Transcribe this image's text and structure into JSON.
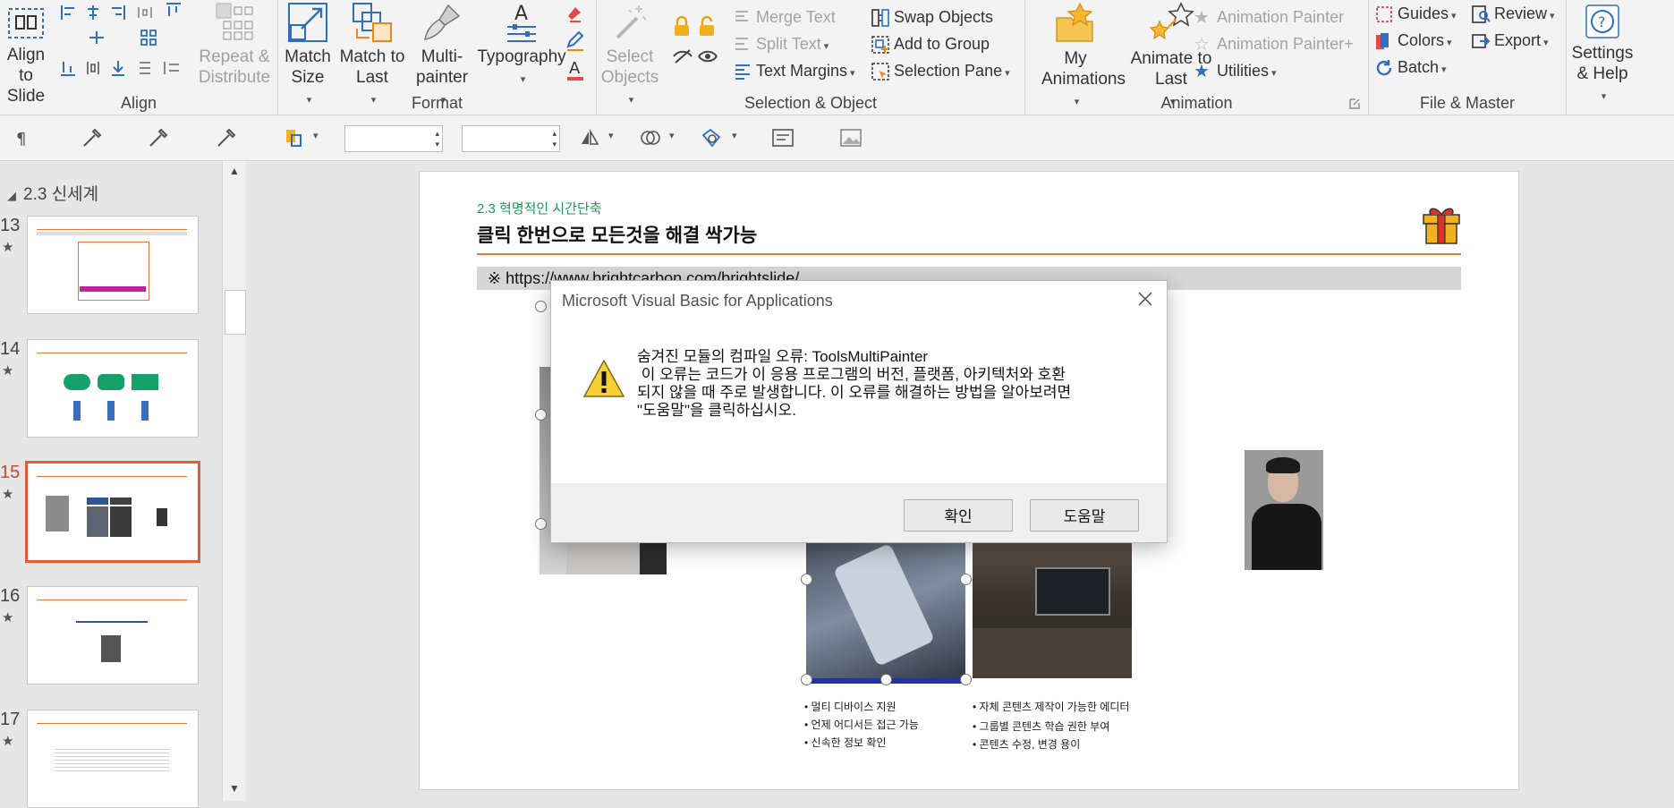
{
  "ribbon": {
    "align": {
      "title": "Align",
      "align_to_slide": "Align to Slide",
      "repeat_distribute": "Repeat & Distribute"
    },
    "format": {
      "title": "Format",
      "match_size": "Match Size",
      "match_to_last": "Match to Last",
      "multi_painter": "Multi-painter",
      "typography": "Typography"
    },
    "selection": {
      "title": "Selection & Object",
      "select_objects": "Select Objects",
      "merge_text": "Merge Text",
      "split_text": "Split Text",
      "text_margins": "Text Margins",
      "swap_objects": "Swap Objects",
      "add_to_group": "Add to Group",
      "selection_pane": "Selection Pane"
    },
    "animation": {
      "title": "Animation",
      "my_animations": "My Animations",
      "animate_to_last": "Animate to Last",
      "animation_painter": "Animation Painter",
      "animation_painter_plus": "Animation Painter+",
      "utilities": "Utilities"
    },
    "file_master": {
      "title": "File & Master",
      "guides": "Guides",
      "colors": "Colors",
      "batch": "Batch",
      "review": "Review",
      "export": "Export"
    },
    "settings": "Settings & Help"
  },
  "slides_pane": {
    "section": "2.3 신세계",
    "slides": [
      {
        "num": "13"
      },
      {
        "num": "14"
      },
      {
        "num": "15"
      },
      {
        "num": "16"
      },
      {
        "num": "17"
      }
    ]
  },
  "slide": {
    "subtitle": "2.3 혁명적인 시간단축",
    "title": "클릭 한번으로 모든것을 해결 싹가능",
    "url": "※ https://www.brightcarbon.com/brightslide/",
    "bullets_left": [
      "멀티 디바이스 지원",
      "언제 어디서든 접근 가능",
      "신속한 정보 확인"
    ],
    "bullets_right": [
      "자체 콘텐츠 제작이 가능한 에디터",
      "그룹별 콘텐츠 학습 권한 부여",
      "콘텐츠 수정, 변경 용이"
    ]
  },
  "dialog": {
    "title": "Microsoft Visual Basic for Applications",
    "lines": [
      "숨겨진 모듈의 컴파일 오류: ToolsMultiPainter",
      " 이 오류는 코드가 이 응용 프로그램의 버전, 플랫폼, 아키텍처와 호환",
      "되지 않을 때 주로 발생합니다. 이 오류를 해결하는 방법을 알아보려면",
      "\"도움말\"을 클릭하십시오."
    ],
    "ok": "확인",
    "help": "도움말"
  },
  "colors": {
    "accent_orange": "#e07b39",
    "selected_border": "#e55b33",
    "subtitle_green": "#1e9a5a"
  }
}
